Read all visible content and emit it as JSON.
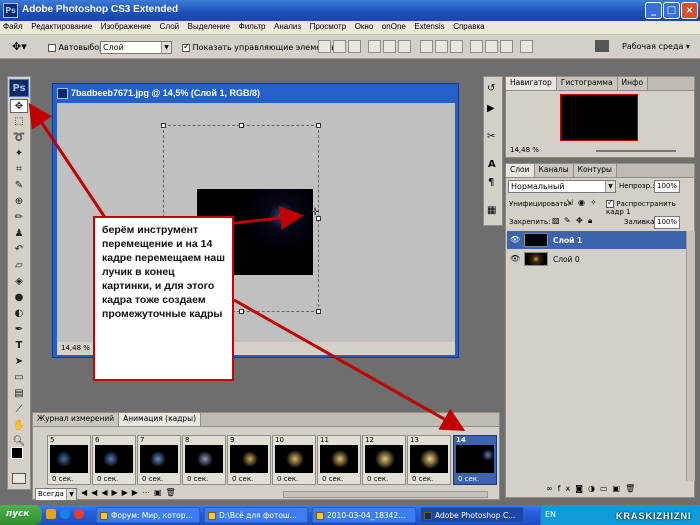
{
  "window": {
    "title": "Adobe Photoshop CS3 Extended",
    "minimize": "_",
    "maximize": "□",
    "close": "×"
  },
  "menu": [
    "Файл",
    "Редактирование",
    "Изображение",
    "Слой",
    "Выделение",
    "Фильтр",
    "Анализ",
    "Просмотр",
    "Окно",
    "onOne",
    "Extensis",
    "Справка"
  ],
  "options": {
    "auto_select_label": "Автовыбор:",
    "auto_select_value": "Слой",
    "show_controls_label": "Показать управляющие элементы",
    "workspace_label": "Рабочая среда ▾"
  },
  "tools": {
    "logo": "Ps"
  },
  "document": {
    "title": "7badbeeb7671.jpg @ 14,5% (Слой 1, RGB/8)",
    "zoom_status": "14,48 %"
  },
  "annotation": {
    "text": "берём инструмент перемещение и на 14 кадре перемещаем наш лучик в конец картинки, и для этого кадра тоже создаем промежуточные кадры"
  },
  "navigator": {
    "tabs": [
      "Навигатор",
      "Гистограмма",
      "Инфо"
    ],
    "zoom": "14,48 %"
  },
  "layers_panel": {
    "tabs": [
      "Слои",
      "Каналы",
      "Контуры"
    ],
    "blend_mode": "Нормальный",
    "opacity_label": "Непрозр.:",
    "opacity_value": "100%",
    "unify_label": "Унифицировать:",
    "propagate_label": "Распространить кадр 1",
    "lock_label": "Закрепить:",
    "fill_label": "Заливка:",
    "fill_value": "100%",
    "layers": [
      {
        "name": "Слой 1",
        "selected": true
      },
      {
        "name": "Слой 0",
        "selected": false
      }
    ]
  },
  "animation": {
    "tabs": [
      "Журнал измерений",
      "Анимация (кадры)"
    ],
    "loop": "Всегда",
    "frames": [
      {
        "num": "5",
        "delay": "0 сек."
      },
      {
        "num": "6",
        "delay": "0 сек."
      },
      {
        "num": "7",
        "delay": "0 сек."
      },
      {
        "num": "8",
        "delay": "0 сек."
      },
      {
        "num": "9",
        "delay": "0 сек."
      },
      {
        "num": "10",
        "delay": "0 сек."
      },
      {
        "num": "11",
        "delay": "0 сек."
      },
      {
        "num": "12",
        "delay": "0 сек."
      },
      {
        "num": "13",
        "delay": "0 сек."
      },
      {
        "num": "14",
        "delay": "0 сек."
      }
    ]
  },
  "taskbar": {
    "start": "пуск",
    "tasks": [
      "Форум: Мир, котор...",
      "D:\\Всё для фотош...",
      "2010-03-04_18342...",
      "Adobe Photoshop C..."
    ],
    "lang": "EN"
  },
  "watermark": "KRASKIZHIZNI",
  "colors": {
    "accent": "#c00000",
    "selection": "#3c63ac"
  }
}
